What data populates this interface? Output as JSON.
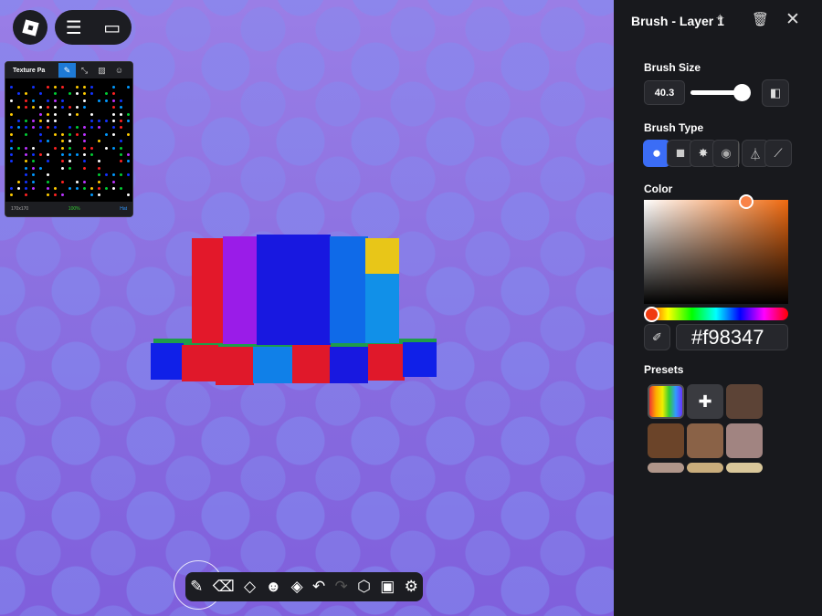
{
  "topbar": {
    "menu_icon": "hamburger-icon",
    "chat_icon": "chat-icon"
  },
  "texture_panel": {
    "title": "Texture Pa",
    "size": "170x170",
    "zoom": "100%",
    "hint": "Hat"
  },
  "toolbar": {
    "tools": [
      "brush-icon",
      "eraser-icon",
      "fill-bucket-icon",
      "sticker-icon",
      "layers-icon",
      "undo-icon",
      "redo-icon",
      "add-3d-object-icon",
      "save-icon",
      "settings-icon"
    ]
  },
  "panel": {
    "title": "Brush - Layer 1",
    "brush_size_label": "Brush Size",
    "brush_size": "40.3",
    "brush_size_fraction": 0.8,
    "brush_type_label": "Brush Type",
    "color_label": "Color",
    "hex": "#f98347",
    "presets_label": "Presets",
    "presets": [
      "#5c4336",
      "#6b4429",
      "#8a6247",
      "#a18481",
      "#b0968a",
      "#c9ad7c",
      "#d9c79a"
    ]
  },
  "colors": {
    "selected": "#3b6df6",
    "panel_bg": "#18191d"
  }
}
